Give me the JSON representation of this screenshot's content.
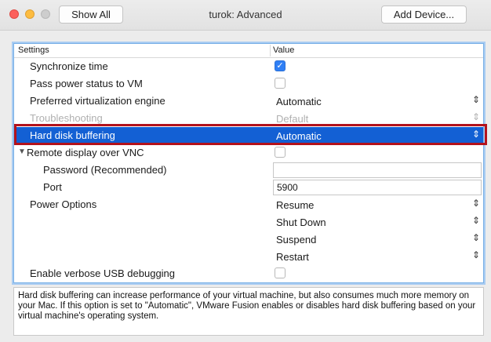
{
  "window": {
    "title": "turok: Advanced",
    "show_all": "Show All",
    "add_device": "Add Device..."
  },
  "table": {
    "col_settings": "Settings",
    "col_value": "Value",
    "rows": {
      "sync_time": {
        "label": "Synchronize time",
        "checked": true
      },
      "pass_power": {
        "label": "Pass power status to VM",
        "checked": false
      },
      "virt_engine": {
        "label": "Preferred virtualization engine",
        "value": "Automatic"
      },
      "troubleshooting": {
        "label": "Troubleshooting",
        "value": "Default"
      },
      "hd_buffering": {
        "label": "Hard disk buffering",
        "value": "Automatic"
      },
      "remote_vnc": {
        "label": "Remote display over VNC",
        "checked": false
      },
      "password": {
        "label": "Password (Recommended)",
        "value": ""
      },
      "port": {
        "label": "Port",
        "value": "5900"
      },
      "power_options": {
        "label": "Power Options",
        "values": [
          "Resume",
          "Shut Down",
          "Suspend",
          "Restart"
        ]
      },
      "usb_debug": {
        "label": "Enable verbose USB debugging",
        "checked": false
      }
    }
  },
  "description": "Hard disk buffering can increase performance of your virtual machine, but also consumes much more memory on your Mac. If this option is set to \"Automatic\", VMware Fusion enables or disables hard disk buffering based on your virtual machine's operating system."
}
